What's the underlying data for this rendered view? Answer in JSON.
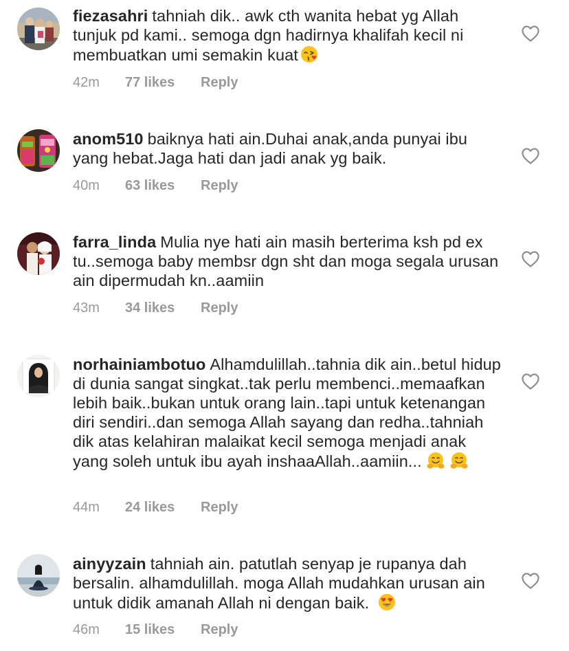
{
  "comments": [
    {
      "username": "fiezasahri",
      "text": "tahniah dik.. awk cth wanita hebat yg Allah tunjuk pd kami.. semoga dgn hadirnya khalifah kecil ni membuatkan umi semakin kuat",
      "emojis": [
        "face-blowing-kiss"
      ],
      "time": "42m",
      "likes": "77 likes",
      "reply": "Reply",
      "avatar": "avatar-family-photo"
    },
    {
      "username": "anom510",
      "text": "baiknya hati ain.Duhai anak,anda punyai ibu yang hebat.Jaga hati dan jadi anak yg baik.",
      "emojis": [],
      "time": "40m",
      "likes": "63 likes",
      "reply": "Reply",
      "avatar": "avatar-drinks-photo"
    },
    {
      "username": "farra_linda",
      "text": "Mulia nye hati ain masih berterima ksh pd ex tu..semoga baby membsr dgn sht dan moga segala urusan ain dipermudah kn..aamiin",
      "emojis": [],
      "time": "43m",
      "likes": "34 likes",
      "reply": "Reply",
      "avatar": "avatar-couple-photo"
    },
    {
      "username": "norhainiambotuo",
      "text": "Alhamdulillah..tahnia dik ain..betul hidup di dunia sangat singkat..tak perlu membenci..memaafkan lebih baik..bukan untuk orang lain..tapi untuk ketenangan diri sendiri..dan semoga Allah sayang dan redha..tahniah dik atas kelahiran malaikat kecil semoga menjadi anak yang soleh untuk ibu ayah inshaaAllah..aamiin...",
      "emojis": [
        "hugging-face",
        "hugging-face"
      ],
      "time": "44m",
      "likes": "24 likes",
      "reply": "Reply",
      "avatar": "avatar-woman-portrait"
    },
    {
      "username": "ainyyzain",
      "text": "tahniah ain. patutlah senyap je rupanya dah bersalin. alhamdulillah. moga Allah mudahkan urusan ain untuk didik amanah Allah ni dengan baik.",
      "emojis": [
        "smiling-face-heart-eyes"
      ],
      "time": "46m",
      "likes": "15 likes",
      "reply": "Reply",
      "avatar": "avatar-beach-photo"
    }
  ],
  "colors": {
    "text": "#262626",
    "meta": "#999999",
    "heart_outline": "#8e8e8e",
    "background": "#ffffff"
  }
}
